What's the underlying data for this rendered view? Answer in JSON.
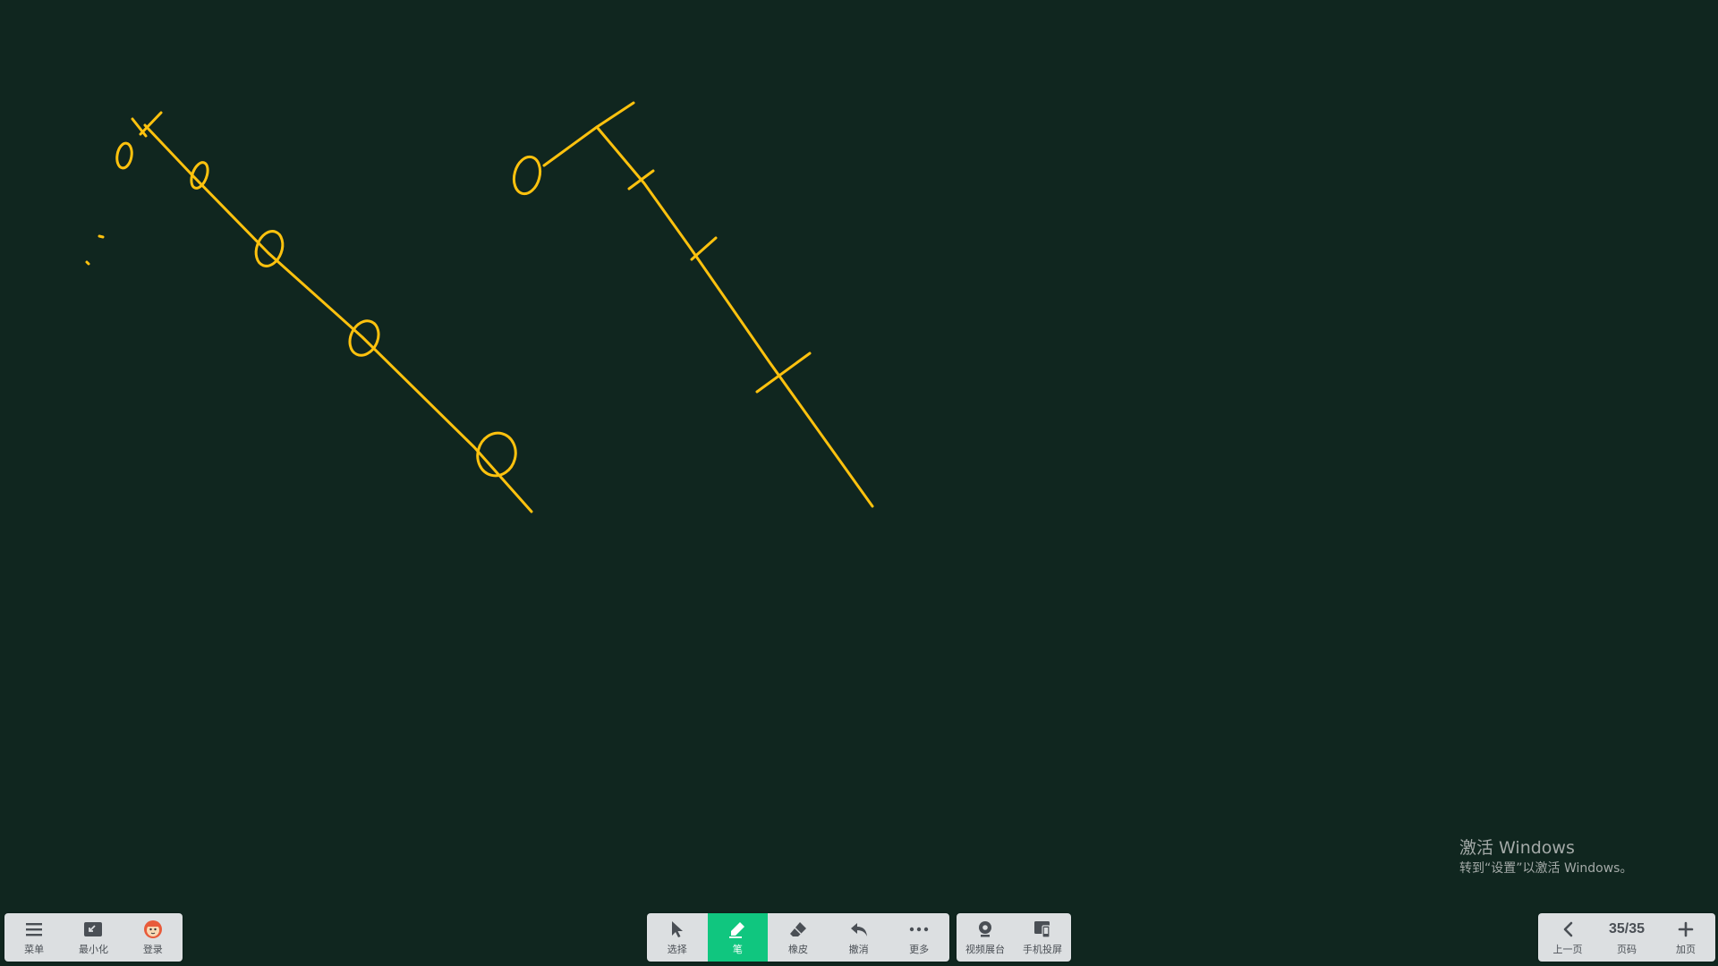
{
  "board": {
    "background_color": "#10261f",
    "ink_color": "#ffc20e"
  },
  "left_toolbar": {
    "menu": {
      "label": "菜单",
      "icon": "hamburger-menu-icon"
    },
    "minimize": {
      "label": "最小化",
      "icon": "minimize-icon"
    },
    "login": {
      "label": "登录",
      "icon": "avatar-icon"
    }
  },
  "center_toolbar": {
    "select": {
      "label": "选择",
      "icon": "cursor-arrow-icon"
    },
    "pen": {
      "label": "笔",
      "icon": "pen-icon",
      "active": true
    },
    "eraser": {
      "label": "橡皮",
      "icon": "eraser-icon"
    },
    "undo": {
      "label": "撤消",
      "icon": "undo-icon"
    },
    "more": {
      "label": "更多",
      "icon": "more-dots-icon"
    }
  },
  "media_toolbar": {
    "video_booth": {
      "label": "视频展台",
      "icon": "webcam-icon"
    },
    "phone_cast": {
      "label": "手机投屏",
      "icon": "phone-cast-icon"
    }
  },
  "page_toolbar": {
    "prev": {
      "label": "上一页",
      "icon": "chevron-left-icon"
    },
    "page": {
      "current_total": "35/35",
      "label": "页码"
    },
    "add": {
      "label": "加页",
      "icon": "plus-icon"
    }
  },
  "watermark": {
    "title": "激活 Windows",
    "subtitle": "转到“设置”以激活 Windows。"
  },
  "accent_color": "#10c67f"
}
